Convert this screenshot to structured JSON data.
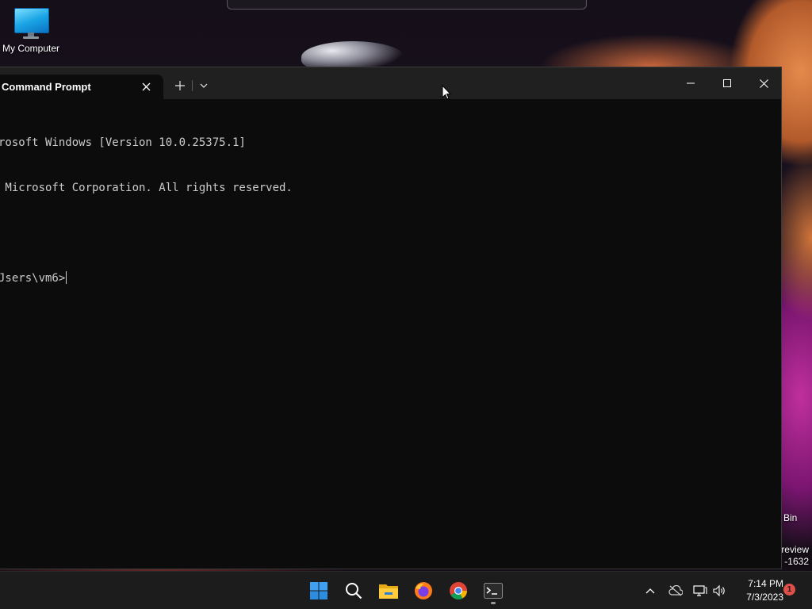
{
  "desktop": {
    "icons": [
      {
        "label": "My Computer",
        "icon": "computer-icon"
      }
    ],
    "recycle_bin_label": "Bin",
    "watermark": {
      "line1": "review",
      "line2": "-1632"
    }
  },
  "terminal": {
    "tab_title": "Command Prompt",
    "tab_close_icon": "close-icon",
    "new_tab_icon": "plus-icon",
    "dropdown_icon": "chevron-down-icon",
    "window_controls": [
      "minimize-icon",
      "maximize-icon",
      "close-icon"
    ],
    "lines": [
      "rosoft Windows [Version 10.0.25375.1]",
      " Microsoft Corporation. All rights reserved.",
      "",
      "Jsers\\vm6>"
    ]
  },
  "taskbar": {
    "apps": [
      {
        "name": "start",
        "icon": "windows-start-icon"
      },
      {
        "name": "search",
        "icon": "search-icon"
      },
      {
        "name": "file-explorer",
        "icon": "folder-icon"
      },
      {
        "name": "firefox",
        "icon": "firefox-icon"
      },
      {
        "name": "chrome",
        "icon": "chrome-icon"
      },
      {
        "name": "terminal",
        "icon": "terminal-icon",
        "running": true
      }
    ],
    "tray_icons": [
      "chevron-up-icon",
      "onedrive-icon",
      "network-icon",
      "volume-icon"
    ],
    "clock": {
      "time": "7:14 PM",
      "date": "7/3/2023"
    },
    "notification_count": "1"
  },
  "colors": {
    "terminal_bg": "#0c0c0c",
    "titlebar_bg": "#202020",
    "taskbar_bg": "#1c1c1c",
    "console_text": "#cccccc",
    "notification": "#e0504a"
  }
}
